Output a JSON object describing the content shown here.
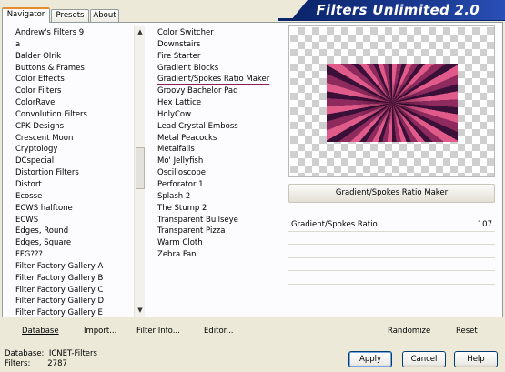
{
  "tabs": [
    "Navigator",
    "Presets",
    "About"
  ],
  "banner": "Filters Unlimited 2.0",
  "categories": [
    "Andrew's Filters 9",
    "a",
    "Balder Olrik",
    "Buttons & Frames",
    "Color Effects",
    "Color Filters",
    "ColorRave",
    "Convolution Filters",
    "CPK Designs",
    "Crescent Moon",
    "Cryptology",
    "DCspecial",
    "Distortion Filters",
    "Distort",
    "Ecosse",
    "ECWS halftone",
    "ECWS",
    "Edges, Round",
    "Edges, Square",
    "FFG???",
    "Filter Factory Gallery A",
    "Filter Factory Gallery B",
    "Filter Factory Gallery C",
    "Filter Factory Gallery D",
    "Filter Factory Gallery E"
  ],
  "filters": [
    "Color Switcher",
    "Downstairs",
    "Fire Starter",
    "Gradient Blocks",
    "Gradient/Spokes Ratio Maker",
    "Groovy Bachelor Pad",
    "Hex Lattice",
    "HolyCow",
    "Lead Crystal Emboss",
    "Metal Peacocks",
    "Metalfalls",
    "Mo' Jellyfish",
    "Oscilloscope",
    "Perforator 1",
    "Splash 2",
    "The Stump 2",
    "Transparent Bullseye",
    "Transparent Pizza",
    "Warm Cloth",
    "Zebra Fan"
  ],
  "filter_name": "Gradient/Spokes Ratio Maker",
  "param": {
    "label": "Gradient/Spokes Ratio",
    "value": "107"
  },
  "actions": {
    "database": "Database",
    "import": "Import...",
    "filter_info": "Filter Info...",
    "editor": "Editor...",
    "randomize": "Randomize",
    "reset": "Reset"
  },
  "info": {
    "db_label": "Database:",
    "db_value": "ICNET-Filters",
    "filters_label": "Filters:",
    "filters_value": "2787"
  },
  "buttons": {
    "apply": "Apply",
    "cancel": "Cancel",
    "help": "Help"
  },
  "colors": {
    "banner": "#0a246a",
    "highlight": "#8b1e5a",
    "tab_accent": "#e68b2c"
  }
}
